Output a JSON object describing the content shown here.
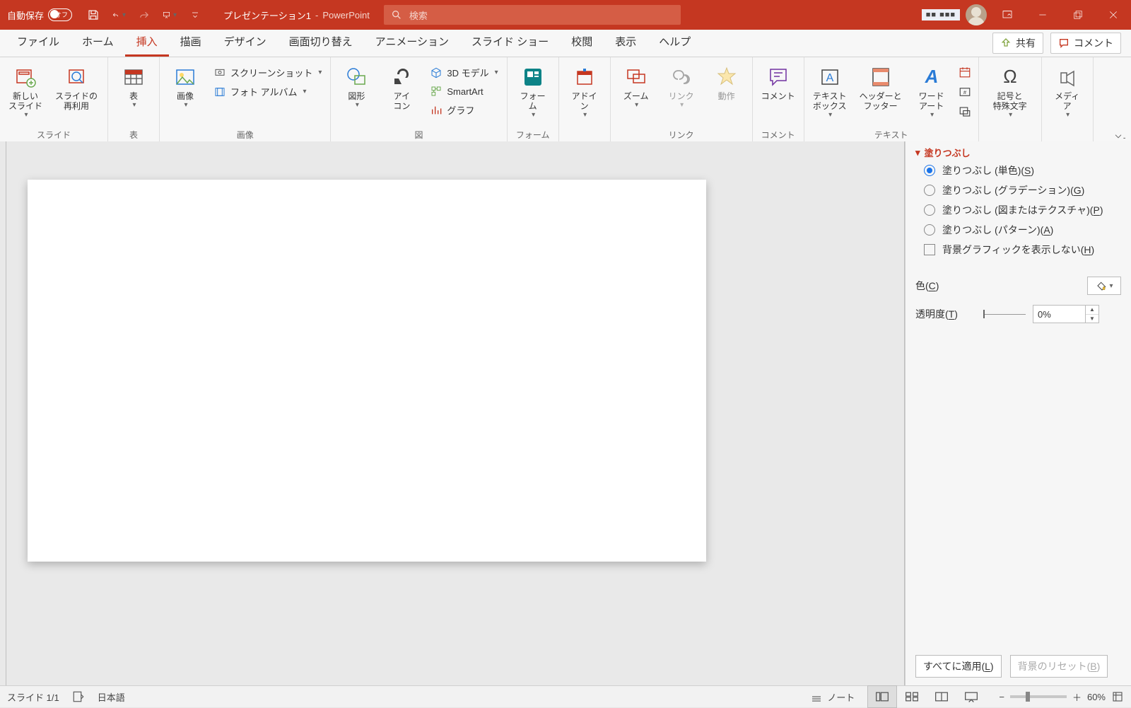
{
  "titlebar": {
    "autosave_label": "自動保存",
    "autosave_toggle": "オフ",
    "doc_name": "プレゼンテーション1",
    "app_sep": " - ",
    "app_name": "PowerPoint",
    "search_placeholder": "検索",
    "account_masked": "■■ ■■■"
  },
  "tabs": {
    "file": "ファイル",
    "home": "ホーム",
    "insert": "挿入",
    "draw": "描画",
    "design": "デザイン",
    "transitions": "画面切り替え",
    "animations": "アニメーション",
    "slideshow": "スライド ショー",
    "review": "校閲",
    "view": "表示",
    "help": "ヘルプ",
    "share": "共有",
    "comment": "コメント"
  },
  "ribbon": {
    "group_slide": "スライド",
    "group_table": "表",
    "group_images": "画像",
    "group_illustrations": "図",
    "group_forms": "フォーム",
    "group_addins": "",
    "group_links": "リンク",
    "group_comments": "コメント",
    "group_text": "テキスト",
    "group_symbols": "",
    "group_media": "",
    "new_slide": "新しい\nスライド",
    "reuse_slides": "スライドの\n再利用",
    "table": "表",
    "pictures": "画像",
    "screenshot": "スクリーンショット",
    "photo_album": "フォト アルバム",
    "shapes": "図形",
    "icons": "アイ\nコン",
    "model3d": "3D モデル",
    "smartart": "SmartArt",
    "chart": "グラフ",
    "forms": "フォー\nム",
    "addins": "アドイ\nン",
    "zoom": "ズーム",
    "link": "リンク",
    "action": "動作",
    "comment": "コメント",
    "textbox": "テキスト\nボックス",
    "header_footer": "ヘッダーと\nフッター",
    "wordart": "ワード\nアート",
    "symbol": "記号と\n特殊文字",
    "media": "メディ\nア"
  },
  "formatPane": {
    "header": "塗りつぶし",
    "fill_solid_pre": "塗りつぶし (単色)(",
    "fill_solid_key": "S",
    "fill_solid_post": ")",
    "fill_gradient_pre": "塗りつぶし (グラデーション)(",
    "fill_gradient_key": "G",
    "fill_gradient_post": ")",
    "fill_picture_pre": "塗りつぶし (図またはテクスチャ)(",
    "fill_picture_key": "P",
    "fill_picture_post": ")",
    "fill_pattern_pre": "塗りつぶし (パターン)(",
    "fill_pattern_key": "A",
    "fill_pattern_post": ")",
    "hide_bg_pre": "背景グラフィックを表示しない(",
    "hide_bg_key": "H",
    "hide_bg_post": ")",
    "color_label_pre": "色(",
    "color_label_key": "C",
    "color_label_post": ")",
    "transparency_label_pre": "透明度(",
    "transparency_label_key": "T",
    "transparency_label_post": ")",
    "transparency_value": "0%",
    "apply_all_pre": "すべてに適用(",
    "apply_all_key": "L",
    "apply_all_post": ")",
    "reset_bg_pre": "背景のリセット(",
    "reset_bg_key": "B",
    "reset_bg_post": ")"
  },
  "status": {
    "slide_indicator": "スライド 1/1",
    "language": "日本語",
    "notes": "ノート",
    "zoom_pct": "60%"
  }
}
